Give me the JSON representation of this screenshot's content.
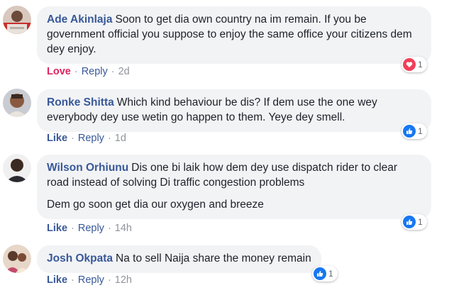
{
  "comments": [
    {
      "author": "Ade Akinlaja",
      "paragraphs": [
        "Soon to get dia own country na im remain. If you be government official you suppose to enjoy the same office your citizens dem dey enjoy."
      ],
      "reaction_label": "Love",
      "reply_label": "Reply",
      "time": "2d",
      "reaction_icon": "heart-icon",
      "reaction_color": "#f33e58",
      "reaction_count": "1"
    },
    {
      "author": "Ronke Shitta",
      "paragraphs": [
        "Which kind behaviour be dis? If dem use the one wey everybody dey use wetin go happen to them. Yeye dey smell."
      ],
      "reaction_label": "Like",
      "reply_label": "Reply",
      "time": "1d",
      "reaction_icon": "thumbs-up-icon",
      "reaction_color": "#1877f2",
      "reaction_count": "1"
    },
    {
      "author": "Wilson Orhiunu",
      "paragraphs": [
        "Dis one bi laik how dem dey use dispatch rider to clear road instead of solving Di traffic congestion problems",
        "Dem go soon get dia our oxygen and breeze"
      ],
      "reaction_label": "Like",
      "reply_label": "Reply",
      "time": "14h",
      "reaction_icon": "thumbs-up-icon",
      "reaction_color": "#1877f2",
      "reaction_count": "1"
    },
    {
      "author": "Josh Okpata",
      "paragraphs": [
        "Na to sell Naija share the money remain"
      ],
      "reaction_label": "Like",
      "reply_label": "Reply",
      "time": "12h",
      "reaction_icon": "thumbs-up-icon",
      "reaction_color": "#1877f2",
      "reaction_count": "1"
    }
  ],
  "separator": "·",
  "colors": {
    "author_link": "#385898",
    "love_accent": "#e0245e",
    "bubble_bg": "#f2f3f5",
    "meta_gray": "#90949c"
  }
}
